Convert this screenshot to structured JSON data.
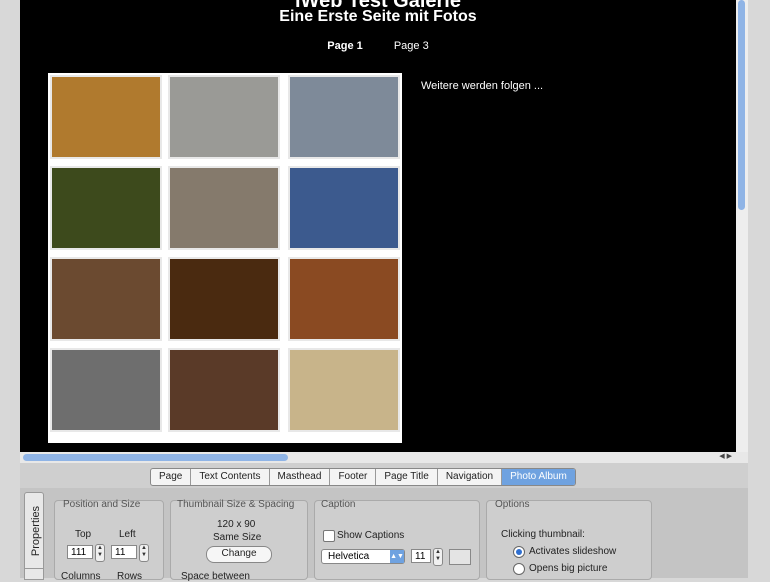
{
  "website": {
    "title": "iWeb Test Galerie",
    "subtitle": "Eine Erste Seite mit Fotos",
    "nav": [
      {
        "label": "Page 1",
        "active": true
      },
      {
        "label": "Page 3",
        "active": false
      }
    ],
    "aside_text": "Weitere werden folgen ...",
    "thumbnails": [
      {
        "name": "book-pages",
        "color": "#b07a2e"
      },
      {
        "name": "bird-in-snow",
        "color": "#9a9a96"
      },
      {
        "name": "ducks-swimming",
        "color": "#7e8a99"
      },
      {
        "name": "green-leaves",
        "color": "#3d4a1c"
      },
      {
        "name": "wood-grain",
        "color": "#857a6c"
      },
      {
        "name": "tree-branches-sky",
        "color": "#3c5a8e"
      },
      {
        "name": "window-interior",
        "color": "#6b4a30"
      },
      {
        "name": "church-at-night",
        "color": "#4a2a10"
      },
      {
        "name": "branches-sunset",
        "color": "#8a4a22"
      },
      {
        "name": "bare-branches-gray",
        "color": "#6e6e6e"
      },
      {
        "name": "man-in-market",
        "color": "#5a3a28"
      },
      {
        "name": "coffee-cup",
        "color": "#c8b48a"
      }
    ]
  },
  "tabs": [
    {
      "label": "Page",
      "active": false
    },
    {
      "label": "Text Contents",
      "active": false
    },
    {
      "label": "Masthead",
      "active": false
    },
    {
      "label": "Footer",
      "active": false
    },
    {
      "label": "Page Title",
      "active": false
    },
    {
      "label": "Navigation",
      "active": false
    },
    {
      "label": "Photo Album",
      "active": true
    }
  ],
  "inspector": {
    "side_tab": "Properties",
    "position_size": {
      "title": "Position and Size",
      "top_label": "Top",
      "left_label": "Left",
      "top_value": "111",
      "left_value": "11",
      "columns_label": "Columns",
      "rows_label": "Rows"
    },
    "thumbnail": {
      "title": "Thumbnail Size & Spacing",
      "size_text": "120 x 90",
      "same_size": "Same Size",
      "change_label": "Change",
      "space_between": "Space between"
    },
    "caption": {
      "title": "Caption",
      "show_captions": "Show Captions",
      "font": "Helvetica",
      "font_size": "11"
    },
    "options": {
      "title": "Options",
      "clicking_label": "Clicking thumbnail:",
      "radio_1": "Activates slideshow",
      "radio_2": "Opens big picture"
    }
  },
  "colors": {
    "accent": "#6fa2e0",
    "canvas_bg": "#000000"
  }
}
